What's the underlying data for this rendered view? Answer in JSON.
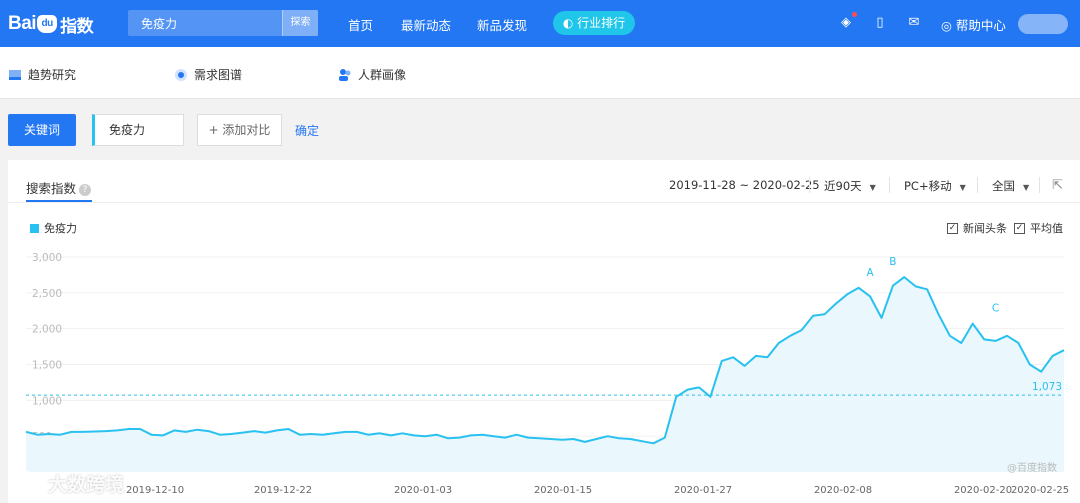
{
  "header": {
    "logo_text": "Bai",
    "logo_paw": "du",
    "logo_suffix": "指数",
    "search_value": "免疫力",
    "search_button": "探索",
    "nav": [
      "首页",
      "最新动态",
      "新品发现"
    ],
    "rank_button": "行业排行",
    "help_label": "帮助中心",
    "icons": [
      "app-icon",
      "mobile-icon",
      "wechat-icon",
      "help-icon"
    ],
    "accent_color": "#2377f2"
  },
  "subnav": {
    "items": [
      "趋势研究",
      "需求图谱",
      "人群画像"
    ]
  },
  "keyword_bar": {
    "keyword_button": "关键词",
    "keyword": "免疫力",
    "add_compare": "+ 添加对比",
    "confirm": "确定"
  },
  "panel": {
    "tab_title": "搜索指数",
    "date_range": "2019-11-28 ~ 2020-02-25",
    "period": "近90天",
    "device": "PC+移动",
    "region": "全国",
    "checkbox_news": "新闻头条",
    "checkbox_avg": "平均值",
    "corner_watermark": "@百度指数",
    "bottom_watermark": "大数跨境"
  },
  "chart_data": {
    "type": "area",
    "series": [
      {
        "name": "免疫力",
        "color": "#29c1f0"
      }
    ],
    "x_labels": [
      "2019-12-10",
      "2019-12-22",
      "2020-01-03",
      "2020-01-15",
      "2020-01-27",
      "2020-02-08",
      "2020-02-20",
      "2020-02-25"
    ],
    "y_ticks": [
      "3,000",
      "2,500",
      "2,000",
      "1,500",
      "1,000",
      "500"
    ],
    "ylim": [
      0,
      3000
    ],
    "average": 1073,
    "average_label": "1,073",
    "annotations": [
      {
        "label": "A",
        "date": "2020-02-10",
        "value": 2570
      },
      {
        "label": "B",
        "date": "2020-02-12",
        "value": 2720
      },
      {
        "label": "C",
        "date": "2020-02-21",
        "value": 2070
      }
    ],
    "values": [
      560,
      520,
      530,
      520,
      560,
      560,
      565,
      570,
      580,
      600,
      600,
      520,
      510,
      580,
      560,
      590,
      570,
      520,
      530,
      550,
      570,
      550,
      580,
      600,
      520,
      530,
      520,
      540,
      560,
      560,
      520,
      540,
      510,
      540,
      510,
      500,
      520,
      470,
      480,
      510,
      520,
      500,
      480,
      520,
      480,
      470,
      460,
      450,
      460,
      420,
      460,
      500,
      470,
      460,
      430,
      400,
      480,
      1050,
      1150,
      1180,
      1050,
      1550,
      1600,
      1480,
      1620,
      1600,
      1800,
      1900,
      1980,
      2180,
      2200,
      2350,
      2480,
      2570,
      2450,
      2150,
      2600,
      2720,
      2590,
      2550,
      2200,
      1900,
      1800,
      2070,
      1850,
      1830,
      1900,
      1800,
      1500,
      1400,
      1620,
      1700
    ]
  }
}
